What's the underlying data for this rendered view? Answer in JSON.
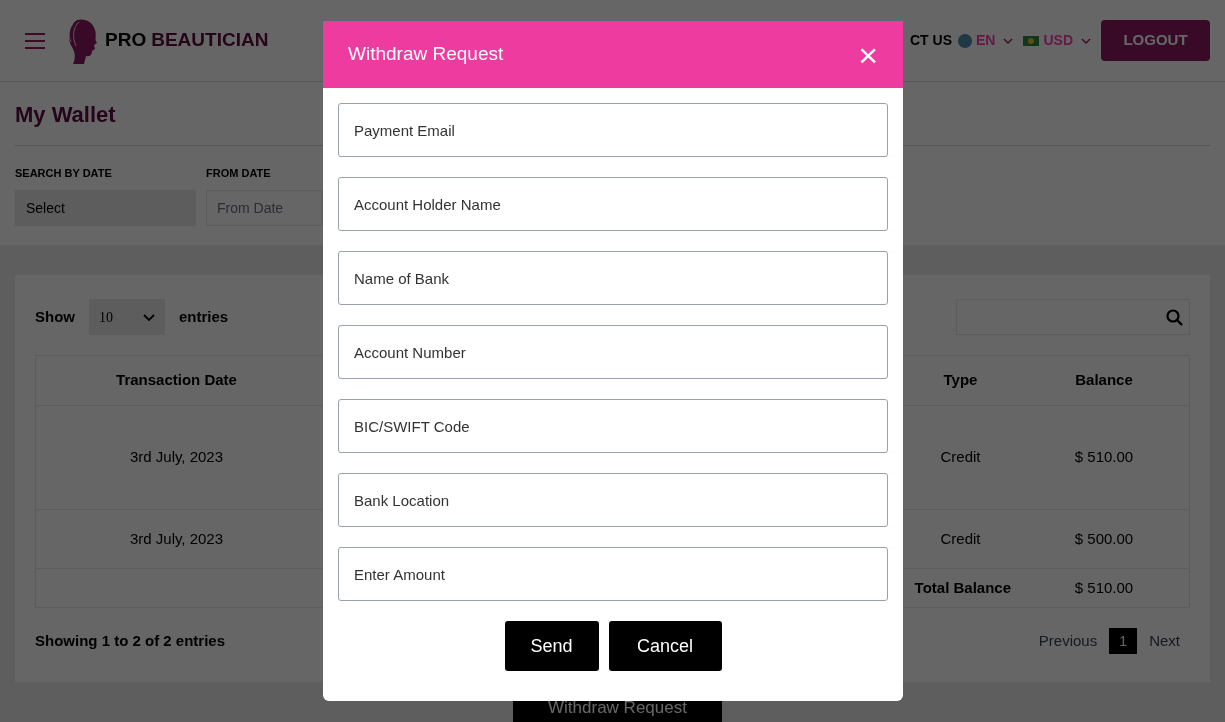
{
  "header": {
    "brand_first": "PRO",
    "brand_second": "BEAUTICIAN",
    "nav_link": "CT US",
    "language": "EN",
    "currency": "USD",
    "logout": "LOGOUT"
  },
  "page_title": "My Wallet",
  "filters": [
    {
      "label": "SEARCH BY DATE",
      "value": "Select"
    },
    {
      "label": "FROM DATE",
      "placeholder": "From Date"
    }
  ],
  "table_controls": {
    "show": "Show",
    "page_size": "10",
    "entries": "entries"
  },
  "table": {
    "columns": [
      "Transaction Date",
      "Type",
      "Balance"
    ],
    "rows": [
      {
        "cells": [
          "3rd July, 2023",
          "Credit",
          "$ 510.00"
        ],
        "tall": true
      },
      {
        "cells": [
          "3rd July, 2023",
          "Credit",
          "$ 500.00"
        ],
        "tall": false
      }
    ],
    "total": {
      "label": "Total Balance",
      "value": "$ 510.00"
    }
  },
  "footer": {
    "info": "Showing 1 to 2 of 2 entries",
    "previous": "Previous",
    "pages": [
      {
        "label": "1",
        "selected": true
      }
    ],
    "next": "Next"
  },
  "withdraw_button": "Withdraw Request",
  "modal": {
    "title": "Withdraw Request",
    "close": "×",
    "fields": [
      {
        "placeholder": "Payment Email"
      },
      {
        "placeholder": "Account Holder Name"
      },
      {
        "placeholder": "Name of Bank"
      },
      {
        "placeholder": "Account Number"
      },
      {
        "placeholder": "BIC/SWIFT Code"
      },
      {
        "placeholder": "Bank Location"
      },
      {
        "placeholder": "Enter Amount"
      }
    ],
    "buttons": [
      "Send",
      "Cancel"
    ]
  }
}
